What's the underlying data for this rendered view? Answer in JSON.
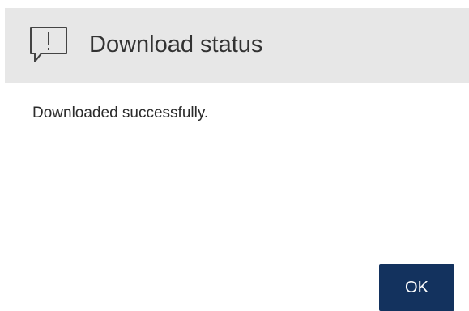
{
  "dialog": {
    "title": "Download status",
    "icon": "alert-speech-bubble-icon",
    "message": "Downloaded successfully.",
    "ok_label": "OK"
  },
  "colors": {
    "header_background": "#e7e7e7",
    "button_background": "#13325e",
    "button_text": "#ffffff",
    "text": "#333333"
  }
}
